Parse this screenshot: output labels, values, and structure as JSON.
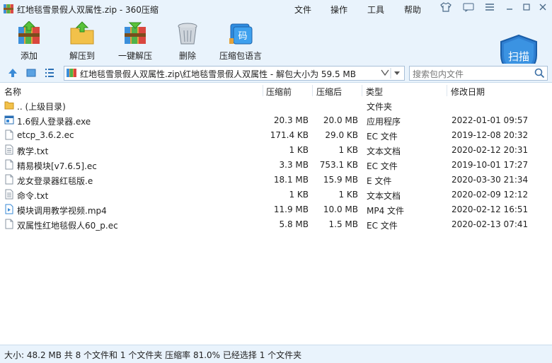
{
  "window": {
    "title": "红地毯雪景假人双属性.zip - 360压缩",
    "menu": [
      "文件",
      "操作",
      "工具",
      "帮助"
    ]
  },
  "toolbar": {
    "add": "添加",
    "extract_to": "解压到",
    "one_click_extract": "一键解压",
    "delete": "删除",
    "language": "压缩包语言",
    "scan": "扫描"
  },
  "pathbar": {
    "path": "红地毯雪景假人双属性.zip\\红地毯雪景假人双属性 - 解包大小为 59.5 MB",
    "search_placeholder": "搜索包内文件"
  },
  "columns": {
    "name": "名称",
    "before": "压缩前",
    "after": "压缩后",
    "type": "类型",
    "modified": "修改日期"
  },
  "files": [
    {
      "name": ".. (上级目录)",
      "before": "",
      "after": "",
      "type": "文件夹",
      "modified": "",
      "icon": "folder-icon"
    },
    {
      "name": "1.6假人登录器.exe",
      "before": "20.3 MB",
      "after": "20.0 MB",
      "type": "应用程序",
      "modified": "2022-01-01 09:57",
      "icon": "exe-icon"
    },
    {
      "name": "etcp_3.6.2.ec",
      "before": "171.4 KB",
      "after": "29.0 KB",
      "type": "EC 文件",
      "modified": "2019-12-08 20:32",
      "icon": "file-icon"
    },
    {
      "name": "教学.txt",
      "before": "1 KB",
      "after": "1 KB",
      "type": "文本文档",
      "modified": "2020-02-12 20:31",
      "icon": "text-file-icon"
    },
    {
      "name": "精易模块[v7.6.5].ec",
      "before": "3.3 MB",
      "after": "753.1 KB",
      "type": "EC 文件",
      "modified": "2019-10-01 17:27",
      "icon": "file-icon"
    },
    {
      "name": "龙女登录器红毯版.e",
      "before": "18.1 MB",
      "after": "15.9 MB",
      "type": "E 文件",
      "modified": "2020-03-30 21:34",
      "icon": "file-icon"
    },
    {
      "name": "命令.txt",
      "before": "1 KB",
      "after": "1 KB",
      "type": "文本文档",
      "modified": "2020-02-09 12:12",
      "icon": "text-file-icon"
    },
    {
      "name": "模块调用教学视频.mp4",
      "before": "11.9 MB",
      "after": "10.0 MB",
      "type": "MP4 文件",
      "modified": "2020-02-12 16:51",
      "icon": "video-file-icon"
    },
    {
      "name": "双属性红地毯假人60_p.ec",
      "before": "5.8 MB",
      "after": "1.5 MB",
      "type": "EC 文件",
      "modified": "2020-02-13 07:41",
      "icon": "file-icon"
    }
  ],
  "status": "大小: 48.2 MB 共 8 个文件和 1 个文件夹 压缩率 81.0% 已经选择 1 个文件夹",
  "colors": {
    "chrome": "#e9f3fc",
    "border": "#c9dbec",
    "accent": "#2a7fd0"
  }
}
